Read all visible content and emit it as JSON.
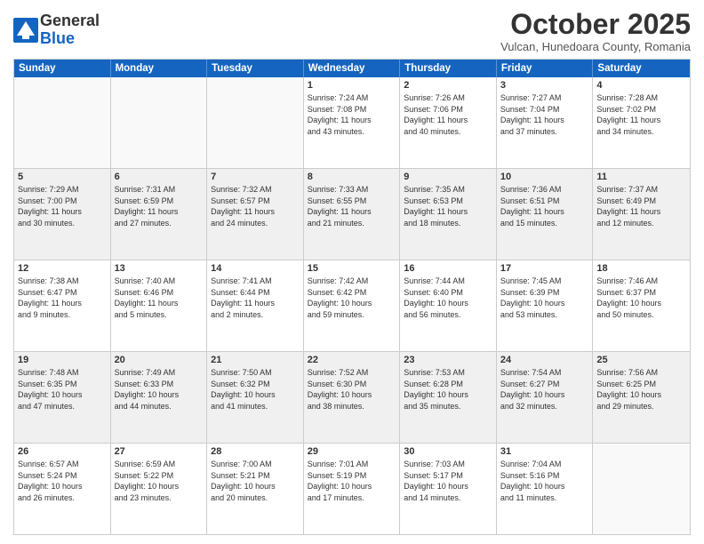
{
  "logo": {
    "line1": "General",
    "line2": "Blue"
  },
  "header": {
    "month": "October 2025",
    "location": "Vulcan, Hunedoara County, Romania"
  },
  "days": [
    "Sunday",
    "Monday",
    "Tuesday",
    "Wednesday",
    "Thursday",
    "Friday",
    "Saturday"
  ],
  "rows": [
    [
      {
        "day": "",
        "text": ""
      },
      {
        "day": "",
        "text": ""
      },
      {
        "day": "",
        "text": ""
      },
      {
        "day": "1",
        "text": "Sunrise: 7:24 AM\nSunset: 7:08 PM\nDaylight: 11 hours\nand 43 minutes."
      },
      {
        "day": "2",
        "text": "Sunrise: 7:26 AM\nSunset: 7:06 PM\nDaylight: 11 hours\nand 40 minutes."
      },
      {
        "day": "3",
        "text": "Sunrise: 7:27 AM\nSunset: 7:04 PM\nDaylight: 11 hours\nand 37 minutes."
      },
      {
        "day": "4",
        "text": "Sunrise: 7:28 AM\nSunset: 7:02 PM\nDaylight: 11 hours\nand 34 minutes."
      }
    ],
    [
      {
        "day": "5",
        "text": "Sunrise: 7:29 AM\nSunset: 7:00 PM\nDaylight: 11 hours\nand 30 minutes."
      },
      {
        "day": "6",
        "text": "Sunrise: 7:31 AM\nSunset: 6:59 PM\nDaylight: 11 hours\nand 27 minutes."
      },
      {
        "day": "7",
        "text": "Sunrise: 7:32 AM\nSunset: 6:57 PM\nDaylight: 11 hours\nand 24 minutes."
      },
      {
        "day": "8",
        "text": "Sunrise: 7:33 AM\nSunset: 6:55 PM\nDaylight: 11 hours\nand 21 minutes."
      },
      {
        "day": "9",
        "text": "Sunrise: 7:35 AM\nSunset: 6:53 PM\nDaylight: 11 hours\nand 18 minutes."
      },
      {
        "day": "10",
        "text": "Sunrise: 7:36 AM\nSunset: 6:51 PM\nDaylight: 11 hours\nand 15 minutes."
      },
      {
        "day": "11",
        "text": "Sunrise: 7:37 AM\nSunset: 6:49 PM\nDaylight: 11 hours\nand 12 minutes."
      }
    ],
    [
      {
        "day": "12",
        "text": "Sunrise: 7:38 AM\nSunset: 6:47 PM\nDaylight: 11 hours\nand 9 minutes."
      },
      {
        "day": "13",
        "text": "Sunrise: 7:40 AM\nSunset: 6:46 PM\nDaylight: 11 hours\nand 5 minutes."
      },
      {
        "day": "14",
        "text": "Sunrise: 7:41 AM\nSunset: 6:44 PM\nDaylight: 11 hours\nand 2 minutes."
      },
      {
        "day": "15",
        "text": "Sunrise: 7:42 AM\nSunset: 6:42 PM\nDaylight: 10 hours\nand 59 minutes."
      },
      {
        "day": "16",
        "text": "Sunrise: 7:44 AM\nSunset: 6:40 PM\nDaylight: 10 hours\nand 56 minutes."
      },
      {
        "day": "17",
        "text": "Sunrise: 7:45 AM\nSunset: 6:39 PM\nDaylight: 10 hours\nand 53 minutes."
      },
      {
        "day": "18",
        "text": "Sunrise: 7:46 AM\nSunset: 6:37 PM\nDaylight: 10 hours\nand 50 minutes."
      }
    ],
    [
      {
        "day": "19",
        "text": "Sunrise: 7:48 AM\nSunset: 6:35 PM\nDaylight: 10 hours\nand 47 minutes."
      },
      {
        "day": "20",
        "text": "Sunrise: 7:49 AM\nSunset: 6:33 PM\nDaylight: 10 hours\nand 44 minutes."
      },
      {
        "day": "21",
        "text": "Sunrise: 7:50 AM\nSunset: 6:32 PM\nDaylight: 10 hours\nand 41 minutes."
      },
      {
        "day": "22",
        "text": "Sunrise: 7:52 AM\nSunset: 6:30 PM\nDaylight: 10 hours\nand 38 minutes."
      },
      {
        "day": "23",
        "text": "Sunrise: 7:53 AM\nSunset: 6:28 PM\nDaylight: 10 hours\nand 35 minutes."
      },
      {
        "day": "24",
        "text": "Sunrise: 7:54 AM\nSunset: 6:27 PM\nDaylight: 10 hours\nand 32 minutes."
      },
      {
        "day": "25",
        "text": "Sunrise: 7:56 AM\nSunset: 6:25 PM\nDaylight: 10 hours\nand 29 minutes."
      }
    ],
    [
      {
        "day": "26",
        "text": "Sunrise: 6:57 AM\nSunset: 5:24 PM\nDaylight: 10 hours\nand 26 minutes."
      },
      {
        "day": "27",
        "text": "Sunrise: 6:59 AM\nSunset: 5:22 PM\nDaylight: 10 hours\nand 23 minutes."
      },
      {
        "day": "28",
        "text": "Sunrise: 7:00 AM\nSunset: 5:21 PM\nDaylight: 10 hours\nand 20 minutes."
      },
      {
        "day": "29",
        "text": "Sunrise: 7:01 AM\nSunset: 5:19 PM\nDaylight: 10 hours\nand 17 minutes."
      },
      {
        "day": "30",
        "text": "Sunrise: 7:03 AM\nSunset: 5:17 PM\nDaylight: 10 hours\nand 14 minutes."
      },
      {
        "day": "31",
        "text": "Sunrise: 7:04 AM\nSunset: 5:16 PM\nDaylight: 10 hours\nand 11 minutes."
      },
      {
        "day": "",
        "text": ""
      }
    ]
  ]
}
